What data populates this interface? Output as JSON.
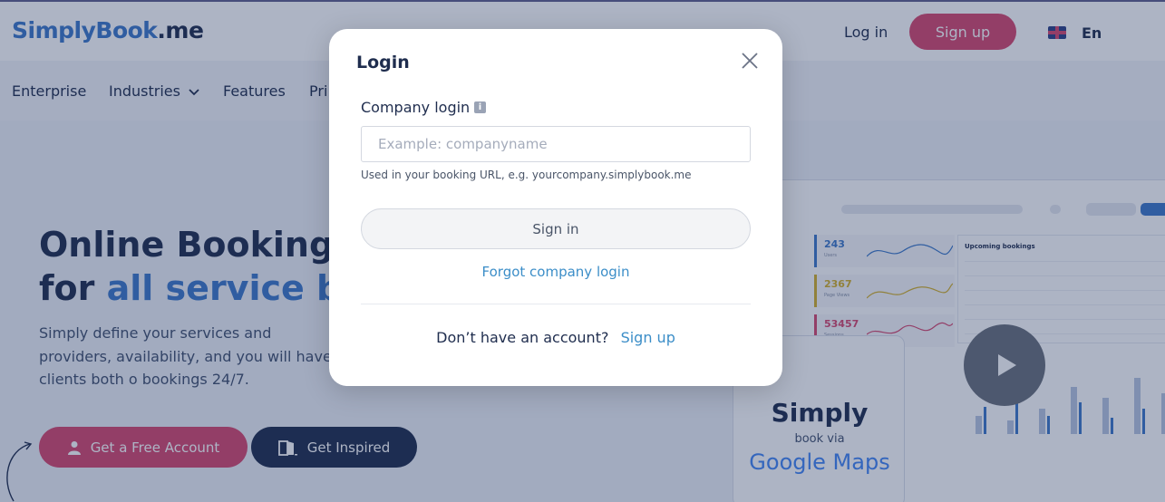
{
  "header": {
    "logo_part1": "SimplyBook",
    "logo_part2": ".me",
    "login_label": "Log in",
    "signup_label": "Sign up",
    "language": "En"
  },
  "nav": {
    "items": [
      {
        "label": "Enterprise"
      },
      {
        "label": "Industries"
      },
      {
        "label": "Features"
      },
      {
        "label": "Pri"
      }
    ]
  },
  "hero": {
    "title_line1": "Online Booking S",
    "title_line2_plain": "for",
    "title_line2_accent": "all service bas",
    "description": "Simply define your services and providers, availability, and you will have clients both o bookings 24/7.",
    "btn_free_label": "Get a Free Account",
    "btn_inspired_label": "Get Inspired"
  },
  "dashboard": {
    "stats": [
      {
        "value": "243",
        "label": "Users",
        "color": "#3c78c8"
      },
      {
        "value": "2367",
        "label": "Page Views",
        "color": "#d4b02a"
      },
      {
        "value": "53457",
        "label": "Sessions",
        "color": "#d6476e"
      }
    ],
    "bookings_title": "Upcoming bookings",
    "maps_simply": "Simply",
    "maps_via": "book via",
    "maps_brand": "Google Maps"
  },
  "modal": {
    "title": "Login",
    "company_login_label": "Company login",
    "info_icon_text": "i",
    "input_placeholder": "Example: companyname",
    "input_value": "",
    "hint": "Used in your booking URL, e.g. yourcompany.simplybook.me",
    "signin_label": "Sign in",
    "forgot_label": "Forgot company login",
    "no_account_text": "Don’t have an account?",
    "signup_link_label": "Sign up"
  },
  "colors": {
    "accent_pink": "#d6476e",
    "navy": "#1f2d4e",
    "link_blue": "#3c8ec8"
  }
}
